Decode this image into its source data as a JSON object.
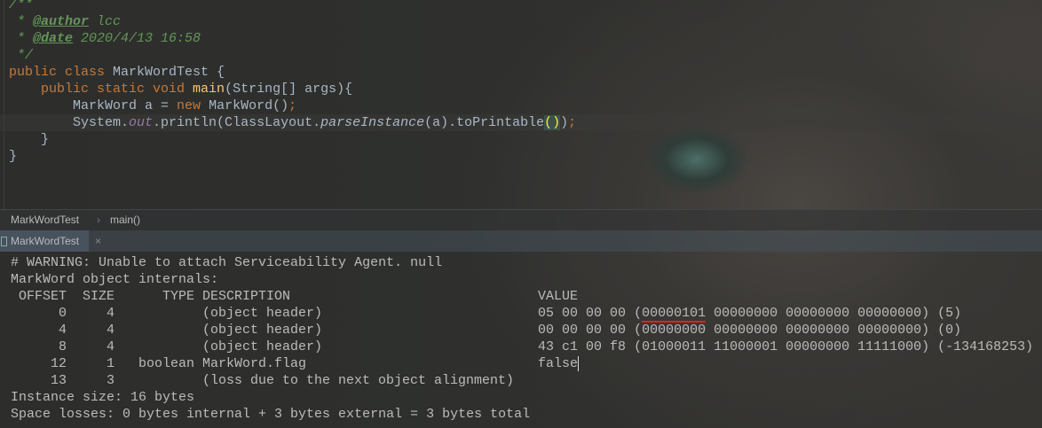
{
  "editor": {
    "javadoc_open": "/**",
    "author_tag": "@author",
    "author": " lcc",
    "date_tag": "@date",
    "date": " 2020/4/13 16:58",
    "javadoc_close": " */",
    "class_kw": "public class ",
    "class_name": "MarkWordTest {",
    "method_kw": "public static void ",
    "method_name": "main",
    "method_params": "(String[] args){",
    "line1_type": "MarkWord a = ",
    "line1_new": "new",
    "line1_rest": " MarkWord()",
    "line1_semi": ";",
    "line2_a": "System.",
    "line2_out": "out",
    "line2_b": ".println(ClassLayout.",
    "line2_parse": "parseInstance",
    "line2_c": "(a).toPrintable",
    "line2_paren": "()",
    "line2_d": ")",
    "line2_semi": ";",
    "close_method": "}",
    "close_class": "}"
  },
  "breadcrumb": {
    "items": [
      "MarkWordTest",
      "main()"
    ],
    "separator": "›"
  },
  "run_tab": {
    "label": "MarkWordTest",
    "close": "×"
  },
  "console": {
    "warning": "# WARNING: Unable to attach Serviceability Agent. null",
    "title": "MarkWord object internals:",
    "headers": {
      "offset": "OFFSET",
      "size": "SIZE",
      "type": "TYPE",
      "description": "DESCRIPTION",
      "value": "VALUE"
    },
    "rows": [
      {
        "offset": "0",
        "size": "4",
        "type": "",
        "description": "(object header)",
        "value_pre": "05 00 00 00 (",
        "value_mark": "00000101",
        "value_post": " 00000000 00000000 00000000) (5)"
      },
      {
        "offset": "4",
        "size": "4",
        "type": "",
        "description": "(object header)",
        "value_pre": "00 00 00 00 (00000000 00000000 00000000 00000000) (0)",
        "value_mark": "",
        "value_post": ""
      },
      {
        "offset": "8",
        "size": "4",
        "type": "",
        "description": "(object header)",
        "value_pre": "43 c1 00 f8 (01000011 11000001 00000000 11111000) (-134168253)",
        "value_mark": "",
        "value_post": ""
      },
      {
        "offset": "12",
        "size": "1",
        "type": "boolean",
        "description": "MarkWord.flag",
        "value_pre": "false",
        "value_mark": "",
        "value_post": ""
      },
      {
        "offset": "13",
        "size": "3",
        "type": "",
        "description": "(loss due to the next object alignment)",
        "value_pre": "",
        "value_mark": "",
        "value_post": ""
      }
    ],
    "instance_size": "Instance size: 16 bytes",
    "space_losses": "Space losses: 0 bytes internal + 3 bytes external = 3 bytes total"
  },
  "colors": {
    "underline": "#e02020",
    "keyword": "#cc7832",
    "comment": "#629755"
  }
}
